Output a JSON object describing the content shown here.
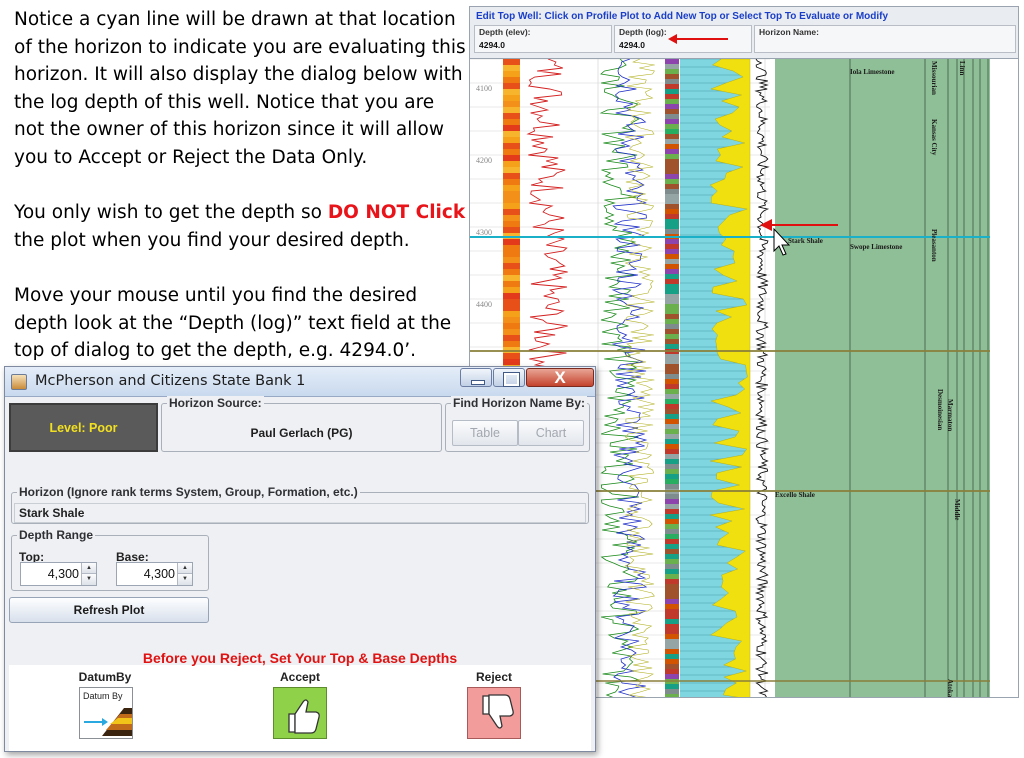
{
  "instructions": {
    "p1": "Notice a cyan line will be drawn at that location of the horizon to indicate you are evaluating this horizon.  It will also display the dialog below with the log depth of this well.  Notice that you are not the owner of this horizon since it will allow you to Accept or Reject the Data Only.",
    "p2_prefix": "You only wish to get the depth so ",
    "p2_highlight": "DO NOT Click",
    "p2_suffix": " the plot when you find your desired depth.",
    "p3": "Move your mouse  until you find the desired depth look at the “Depth (log)” text field at the top of dialog to get the depth, e.g. 4294.0’."
  },
  "plot_window": {
    "title": "Edit Top Well: Click on Profile Plot to Add New Top or Select Top To Evaluate or Modify",
    "depth_elev_label": "Depth (elev):",
    "depth_elev_value": "4294.0",
    "depth_log_label": "Depth (log):",
    "depth_log_value": "4294.0",
    "horizon_name_label": "Horizon Name:",
    "depth_ticks": [
      "4100",
      "4200",
      "4300",
      "4400"
    ],
    "top_labels": [
      "Iola Limestone",
      "Stark Shale",
      "Swope Limestone",
      "Excello Shale"
    ],
    "unit_labels": [
      "Missourian",
      "Linn",
      "Kansas City",
      "Pleasanton",
      "Desmoinesian",
      "Marmaton",
      "Middle",
      "Atoka"
    ],
    "colors": {
      "cyan_line": "#1ab0c8",
      "marker_arrow": "#e01010",
      "right_panel": "#8fbf96",
      "lithology_fill": "#f0e010"
    }
  },
  "dialog": {
    "title": "McPherson and Citizens State Bank 1",
    "close_glyph": "X",
    "level": "Level: Poor",
    "horizon_source_title": "Horizon Source:",
    "horizon_source_value": "Paul Gerlach (PG)",
    "find_title": "Find Horizon Name By:",
    "table_button": "Table",
    "chart_button": "Chart",
    "horizon_title": "Horizon (Ignore rank terms System, Group, Formation, etc.)",
    "horizon_value": "Stark Shale",
    "depth_range_title": "Depth Range",
    "top_label": "Top:",
    "top_value": "4,300",
    "base_label": "Base:",
    "base_value": "4,300",
    "refresh_button": "Refresh Plot",
    "warning": "Before you Reject, Set Your Top & Base Depths",
    "datum_label": "DatumBy",
    "datum_button_text": "Datum By",
    "accept_label": "Accept",
    "reject_label": "Reject",
    "spinner_up_glyph": "▲",
    "spinner_down_glyph": "▼",
    "colors": {
      "level_text": "#f2e020",
      "warning": "#e01212",
      "accept": "#8fd24a",
      "reject": "#f39c9c"
    }
  }
}
